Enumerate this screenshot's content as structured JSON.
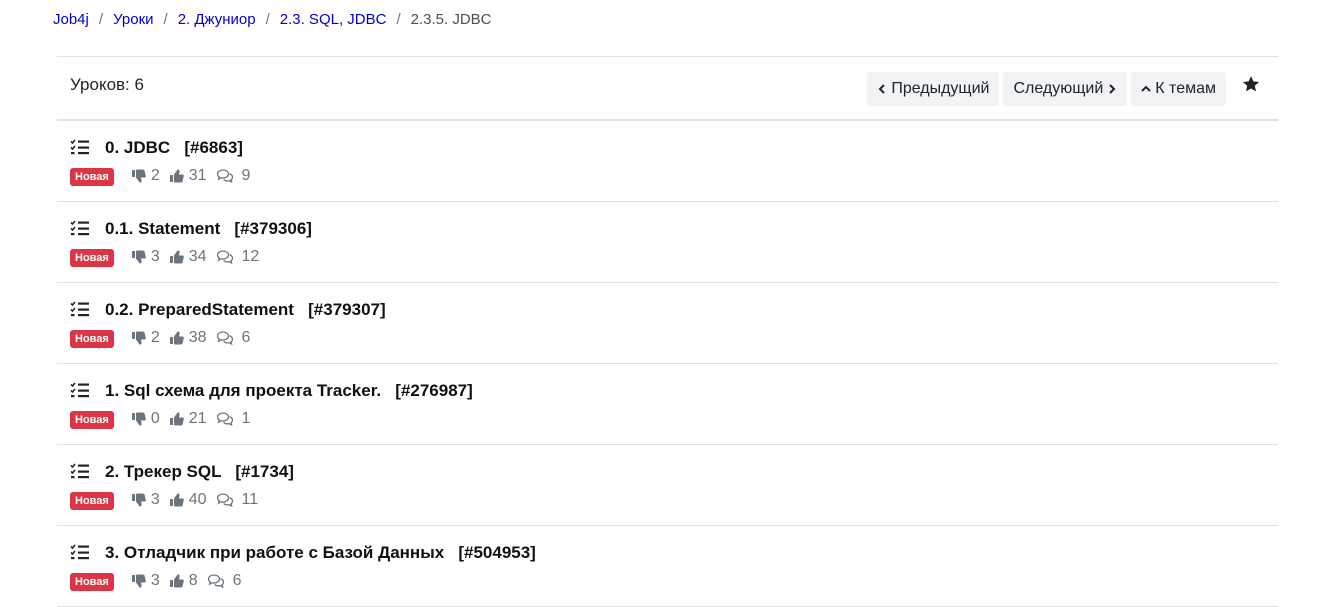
{
  "breadcrumb": {
    "items": [
      {
        "label": "Job4j"
      },
      {
        "label": "Уроки"
      },
      {
        "label": "2. Джуниор"
      },
      {
        "label": "2.3. SQL, JDBC"
      }
    ],
    "current": "2.3.5. JDBC",
    "separator": "/"
  },
  "header": {
    "lesson_count": "Уроков: 6",
    "prev_label": "Предыдущий",
    "next_label": "Следующий",
    "topics_label": "К темам"
  },
  "lessons": [
    {
      "title": "0. JDBC   [#6863]",
      "badge": "Новая",
      "dislikes": "2",
      "likes": "31",
      "comments": "9"
    },
    {
      "title": "0.1. Statement   [#379306]",
      "badge": "Новая",
      "dislikes": "3",
      "likes": "34",
      "comments": "12"
    },
    {
      "title": "0.2. PreparedStatement   [#379307]",
      "badge": "Новая",
      "dislikes": "2",
      "likes": "38",
      "comments": "6"
    },
    {
      "title": "1. Sql схема для проекта Tracker.   [#276987]",
      "badge": "Новая",
      "dislikes": "0",
      "likes": "21",
      "comments": "1"
    },
    {
      "title": "2. Трекер SQL   [#1734]",
      "badge": "Новая",
      "dislikes": "3",
      "likes": "40",
      "comments": "11"
    },
    {
      "title": "3. Отладчик при работе с Базой Данных   [#504953]",
      "badge": "Новая",
      "dislikes": "3",
      "likes": "8",
      "comments": "6"
    }
  ],
  "colors": {
    "link": "#0000cc",
    "badge": "#dc3545",
    "muted": "#6c757d",
    "button_bg": "#f1f3f5"
  },
  "icons": {
    "task": "task-list-icon",
    "dislike": "thumbs-down-icon",
    "like": "thumbs-up-icon",
    "comments": "comments-icon",
    "favorite": "star-icon"
  }
}
